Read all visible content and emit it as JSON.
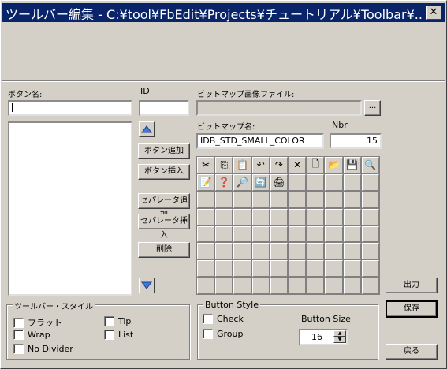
{
  "window": {
    "title": "ツールバー編集 - C:¥tool¥FbEdit¥Projects¥チュートリアル¥Toolbar¥...",
    "close_label": "✕"
  },
  "fields": {
    "button_name_label": "ボタン名:",
    "id_label": "ID",
    "bitmap_file_label": "ビットマップ画像ファイル:",
    "browse_label": "...",
    "bitmap_name_label": "ビットマップ名:",
    "bitmap_name_value": "IDB_STD_SMALL_COLOR",
    "nbr_label": "Nbr",
    "nbr_value": "15"
  },
  "buttons": {
    "add_button": "ボタン追加",
    "insert_button": "ボタン挿入",
    "add_separator": "セパレータ追加",
    "insert_separator": "セパレータ挿入",
    "delete": "削除",
    "output": "出力",
    "save": "保存",
    "back": "戻る"
  },
  "toolbar_style": {
    "title": "ツールバー・スタイル",
    "flat": "フラット",
    "tip": "Tip",
    "wrap": "Wrap",
    "list": "List",
    "no_divider": "No Divider"
  },
  "button_style": {
    "title": "Button Style",
    "check": "Check",
    "group": "Group",
    "size_label": "Button Size",
    "size_value": "16"
  },
  "bitmap_icons": [
    "✂",
    "⎘",
    "📋",
    "↶",
    "↷",
    "✕",
    "🗋",
    "📂",
    "💾",
    "🔍",
    "📝",
    "❓",
    "🔎",
    "🔄",
    "🖨"
  ]
}
